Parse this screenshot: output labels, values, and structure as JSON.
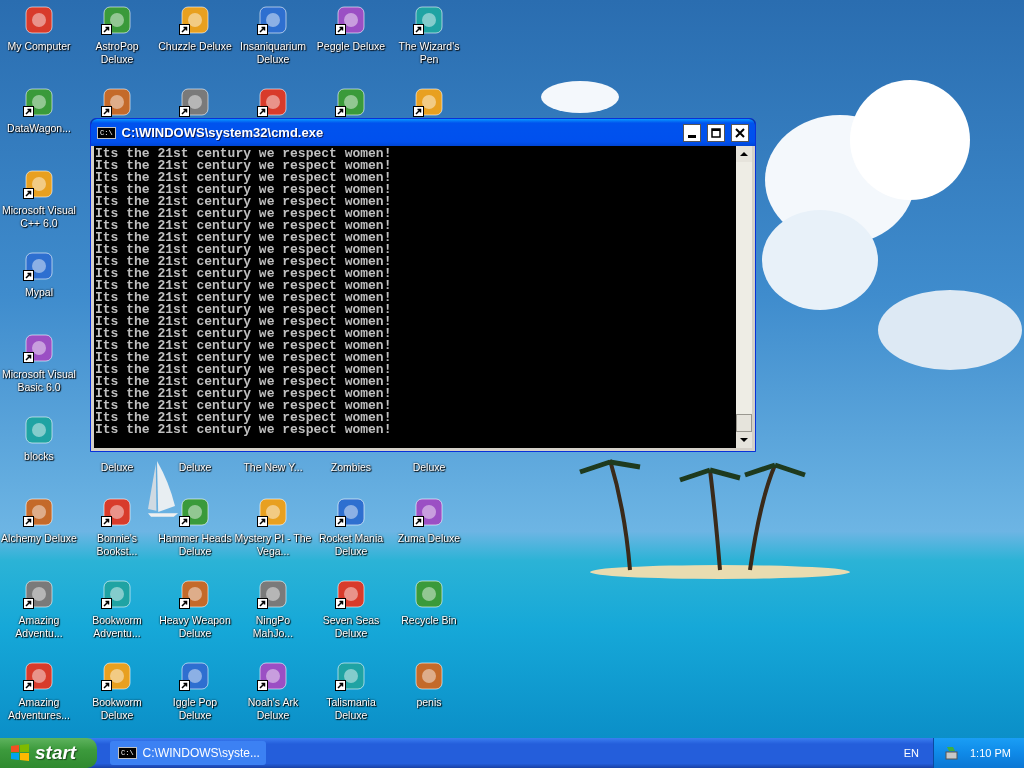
{
  "desktop": {
    "left_column": [
      {
        "label": "My Computer",
        "shortcut": false
      },
      {
        "label": "DataWagon...",
        "shortcut": true
      },
      {
        "label": "Microsoft Visual C++ 6.0",
        "shortcut": true
      },
      {
        "label": "Mypal",
        "shortcut": true
      },
      {
        "label": "Microsoft Visual Basic 6.0",
        "shortcut": true
      },
      {
        "label": "blocks",
        "shortcut": false
      },
      {
        "label": "Alchemy Deluxe",
        "shortcut": true
      },
      {
        "label": "Amazing Adventu...",
        "shortcut": true
      },
      {
        "label": "Amazing Adventures...",
        "shortcut": true
      }
    ],
    "top_rows": [
      [
        {
          "label": "AstroPop Deluxe",
          "shortcut": true
        },
        {
          "label": "Chuzzle Deluxe",
          "shortcut": true
        },
        {
          "label": "Insaniquarium Deluxe",
          "shortcut": true
        },
        {
          "label": "Peggle Deluxe",
          "shortcut": true
        },
        {
          "label": "The Wizard's Pen",
          "shortcut": true
        }
      ],
      [
        {
          "shortcut": true
        },
        {
          "shortcut": true
        },
        {
          "shortcut": true
        },
        {
          "shortcut": true
        },
        {
          "shortcut": true
        }
      ]
    ],
    "bottom_rows": [
      [
        {
          "label": "Deluxe",
          "first_line_hidden": true
        },
        {
          "label": "Deluxe",
          "first_line_hidden": true
        },
        {
          "label": "The New Y...",
          "first_line_hidden": true
        },
        {
          "label": "Zombies",
          "first_line_hidden": true
        },
        {
          "label": "Deluxe",
          "first_line_hidden": true
        }
      ],
      [
        {
          "label": "Bonnie's Bookst...",
          "shortcut": true
        },
        {
          "label": "Hammer Heads Deluxe",
          "shortcut": true
        },
        {
          "label": "Mystery PI - The Vega...",
          "shortcut": true
        },
        {
          "label": "Rocket Mania Deluxe",
          "shortcut": true
        },
        {
          "label": "Zuma Deluxe",
          "shortcut": true
        }
      ],
      [
        {
          "label": "Bookworm Adventu...",
          "shortcut": true
        },
        {
          "label": "Heavy Weapon Deluxe",
          "shortcut": true
        },
        {
          "label": "NingPo MahJo...",
          "shortcut": true
        },
        {
          "label": "Seven Seas Deluxe",
          "shortcut": true
        },
        {
          "label": "Recycle Bin",
          "shortcut": false
        }
      ],
      [
        {
          "label": "Bookworm Deluxe",
          "shortcut": true
        },
        {
          "label": "Iggle Pop Deluxe",
          "shortcut": true
        },
        {
          "label": "Noah's Ark Deluxe",
          "shortcut": true
        },
        {
          "label": "Talismania Deluxe",
          "shortcut": true
        },
        {
          "label": "penis",
          "shortcut": false
        }
      ]
    ]
  },
  "window": {
    "title": "C:\\WINDOWS\\system32\\cmd.exe",
    "icon_text": "C:\\",
    "lines": [
      "Its the 21st century we respect women!",
      "Its the 21st century we respect women!",
      "Its the 21st century we respect women!",
      "Its the 21st century we respect women!",
      "Its the 21st century we respect women!",
      "Its the 21st century we respect women!",
      "Its the 21st century we respect women!",
      "Its the 21st century we respect women!",
      "Its the 21st century we respect women!",
      "Its the 21st century we respect women!",
      "Its the 21st century we respect women!",
      "Its the 21st century we respect women!",
      "Its the 21st century we respect women!",
      "Its the 21st century we respect women!",
      "Its the 21st century we respect women!",
      "Its the 21st century we respect women!",
      "Its the 21st century we respect women!",
      "Its the 21st century we respect women!",
      "Its the 21st century we respect women!",
      "Its the 21st century we respect women!",
      "Its the 21st century we respect women!",
      "Its the 21st century we respect women!",
      "Its the 21st century we respect women!",
      "Its the 21st century we respect women!"
    ]
  },
  "taskbar": {
    "start": "start",
    "tasks": [
      {
        "icon_text": "C:\\",
        "label": "C:\\WINDOWS\\syste...",
        "selected": false
      }
    ],
    "language": "EN",
    "clock": "1:10 PM"
  }
}
